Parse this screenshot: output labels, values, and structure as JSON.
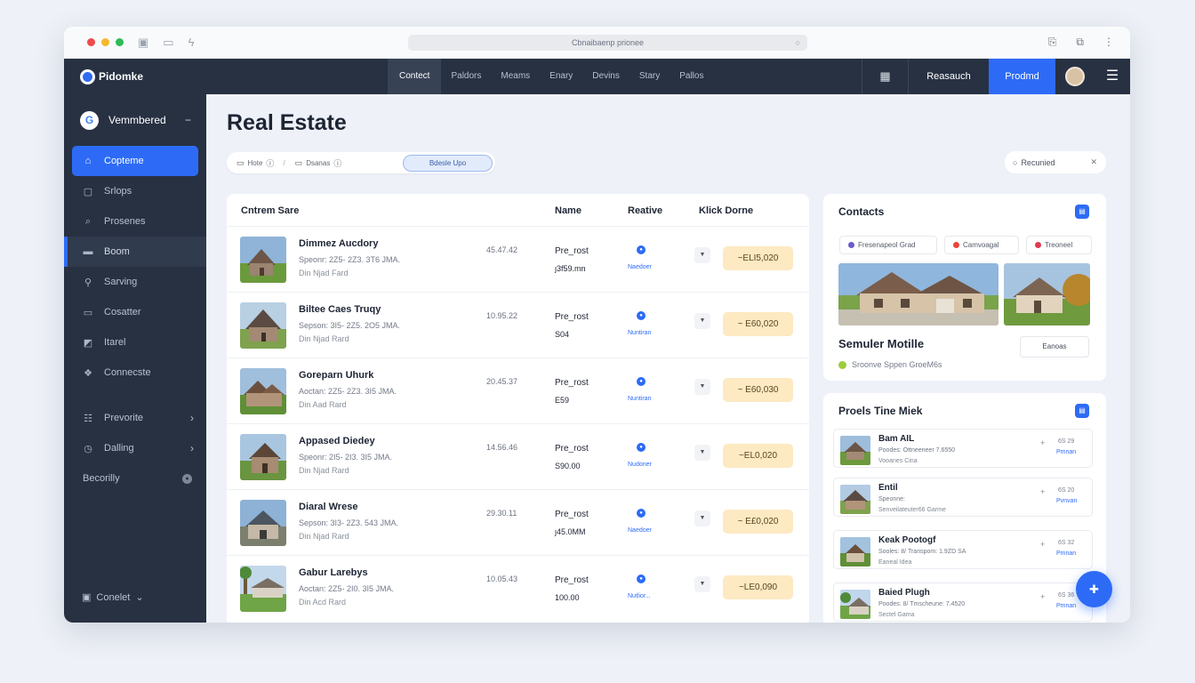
{
  "browser": {
    "url": "Cbnaibaenp prionee",
    "refresh_icon": "refresh-icon"
  },
  "topnav": {
    "brand": "Pidomke",
    "tabs": [
      "Contect",
      "Paldors",
      "Meams",
      "Enary",
      "Devins",
      "Stary",
      "Pallos"
    ],
    "research_label": "Reasauch",
    "product_label": "Prodmd"
  },
  "sidebar": {
    "account_label": "Vemmbered",
    "items": [
      {
        "label": "Copteme",
        "icon": "home-icon"
      },
      {
        "label": "Srlops",
        "icon": "lock-icon"
      },
      {
        "label": "Prosenes",
        "icon": "search-icon"
      },
      {
        "label": "Boom",
        "icon": "folder-icon"
      },
      {
        "label": "Sarving",
        "icon": "pin-icon"
      },
      {
        "label": "Cosatter",
        "icon": "card-icon"
      },
      {
        "label": "Itarel",
        "icon": "image-icon"
      },
      {
        "label": "Connecste",
        "icon": "link-icon"
      }
    ],
    "groups": [
      {
        "label": "Prevorite",
        "icon": "list-icon"
      },
      {
        "label": "Dalling",
        "icon": "clock-icon"
      }
    ],
    "security_label": "Becorilly",
    "bottom_label": "Conelet"
  },
  "page": {
    "title": "Real Estate",
    "filters": {
      "home": "Hote",
      "second": "Dsanas",
      "active": "Bdesle Upo"
    },
    "required_label": "Recunied"
  },
  "table": {
    "headers": {
      "name_col": "Cntrem Sare",
      "name": "Name",
      "relative": "Reative",
      "date": "Klick Dorne"
    },
    "rows": [
      {
        "name": "Dimmez Aucdory",
        "sub1": "Speonr: 2Z5- 2Z3. 3T6 JMA.",
        "sub2": "Din Njad Fard",
        "time": "45.47.42",
        "post": "Pre_rost",
        "val": "ȷ3f59.mn",
        "status": "Naedoer",
        "price": "~ELI5,020"
      },
      {
        "name": "Biltee Caes Truqy",
        "sub1": "Sepson: 3I5- 2Z5. 2O5 JMA.",
        "sub2": "Din Njad Rard",
        "time": "10.95.22",
        "post": "Pre_rost",
        "val": "S04",
        "status": "Nuntiran",
        "price": "~ E60,020"
      },
      {
        "name": "Goreparn Uhurk",
        "sub1": "Aoctan: 2Z5- 2Z3. 3I5 JMA.",
        "sub2": "Din Aad Rard",
        "time": "20.45.37",
        "post": "Pre_rost",
        "val": "E59",
        "status": "Nuntiran",
        "price": "~ E60,030"
      },
      {
        "name": "Appased Diedey",
        "sub1": "Speonr: 2I5- 2I3. 3I5 JMA.",
        "sub2": "Din Njad Rard",
        "time": "14.56.46",
        "post": "Pre_rost",
        "val": "S90.00",
        "status": "Nudoner",
        "price": "~EL0,020"
      },
      {
        "name": "Diaral Wrese",
        "sub1": "Sepson: 3I3- 2Z3. 543 JMA.",
        "sub2": "Din Njad Rard",
        "time": "29.30.11",
        "post": "Pre_rost",
        "val": "ȷ45.0MM",
        "status": "Naedoer",
        "price": "~ E£0,020"
      },
      {
        "name": "Gabur Larebys",
        "sub1": "Aoctan: 2Z5- 2I0. 3I5 JMA.",
        "sub2": "Din Acd Rard",
        "time": "10.05.43",
        "post": "Pre_rost",
        "val": "100.00",
        "status": "Nutlior...",
        "price": "~LE0,090"
      }
    ]
  },
  "contacts": {
    "title": "Contacts",
    "tags": [
      {
        "label": "Fresenapeol Grad",
        "color": "#6a5acd"
      },
      {
        "label": "Camvoagal",
        "color": "#e8463a"
      },
      {
        "label": "Treoneel",
        "color": "#e03a50"
      }
    ],
    "name": "Semuler Motille",
    "subtitle": "Sroonve Sppen GroeM6s",
    "button": "Eanoas"
  },
  "profile": {
    "title": "Proels Tine Miek",
    "items": [
      {
        "name": "Bam AIL",
        "sub1": "Poodes: Ottneeneer 7.6550",
        "sub2": "Vooanes Cina",
        "n": "6S 29",
        "link": "Pmnan"
      },
      {
        "name": "Entil",
        "sub1": "Speonne:",
        "sub2": "Senveilateuter66 Garme",
        "n": "6S 20",
        "link": "Pvnvan"
      },
      {
        "name": "Keak Pootogf",
        "sub1": "Sooles: 8/ Transpom: 1.9ZD SA",
        "sub2": "Eaneal Idea",
        "n": "6S 32",
        "link": "Pmnan"
      },
      {
        "name": "Baied Plugh",
        "sub1": "Poodes: 8/ Tmscheune: 7.4520",
        "sub2": "Sectel Gama",
        "n": "6S 36",
        "link": "Pmnan"
      }
    ]
  },
  "colors": {
    "accent": "#2d6bf6",
    "nav": "#273142",
    "price_bg": "#fde9c2"
  }
}
